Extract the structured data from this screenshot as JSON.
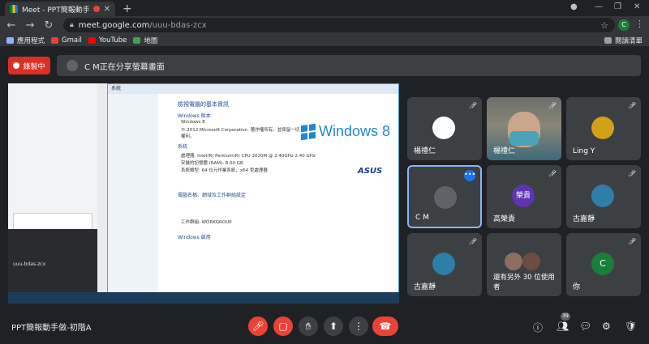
{
  "browser": {
    "tab_title": "Meet - PPT簡報動手做-初階",
    "tab_close": "✕",
    "new_tab": "+",
    "url_host": "meet.google.com",
    "url_path": "/uuu-bdas-zcx",
    "profile_initial": "C",
    "bookmarks": [
      {
        "label": "應用程式",
        "color": "#8ab4f8"
      },
      {
        "label": "Gmail",
        "color": "#ea4335"
      },
      {
        "label": "YouTube",
        "color": "#ff0000"
      },
      {
        "label": "地圖",
        "color": "#34a853"
      }
    ],
    "reading_list": "閱讀清單"
  },
  "meet": {
    "recording_label": "錄製中",
    "presenting_text": "C M正在分享螢幕畫面",
    "meeting_title": "PPT簡報動手做-初階A",
    "participants_count": "39",
    "participants": [
      {
        "name": "楊禮仁",
        "initial": "",
        "color": "#5f6368"
      },
      {
        "name": "楊禮仁",
        "initial": "",
        "color": "video"
      },
      {
        "name": "Ling Y",
        "initial": "",
        "color": "#d4a017"
      },
      {
        "name": "C M",
        "initial": "",
        "color": "#5f6368"
      },
      {
        "name": "高榮貴",
        "initial": "榮貴",
        "color": "#5e35b1"
      },
      {
        "name": "古嘉靜",
        "initial": "",
        "color": "#2d7ea8"
      },
      {
        "name": "古嘉靜",
        "initial": "",
        "color": "#2d7ea8"
      },
      {
        "name": "還有另外 30 位使用者",
        "initial": "",
        "color": "#5f6368"
      },
      {
        "name": "你",
        "initial": "C",
        "color": "#188038"
      }
    ]
  },
  "shared_screen": {
    "dialog_title": "系統",
    "heading": "檢視電腦的基本資訊",
    "sections": [
      "Windows 版本",
      "系統",
      "電腦名稱、網域及工作群組設定",
      "Windows 啟用"
    ],
    "win8_logo": "Windows 8",
    "asus_logo": "ASUS",
    "rows": [
      "Windows 8",
      "© 2012 Microsoft Corporation. 著作權所有，並保留一切權利。",
      "處理器: Intel(R) Pentium(R) CPU 2020M @ 2.40GHz 2.40 GHz",
      "安裝的記憶體 (RAM): 8.00 GB",
      "系統類型: 64 位元作業系統，x64 型處理器",
      "工作群組: WORKGROUP"
    ],
    "caption": "uuu-bdas-zcx"
  }
}
